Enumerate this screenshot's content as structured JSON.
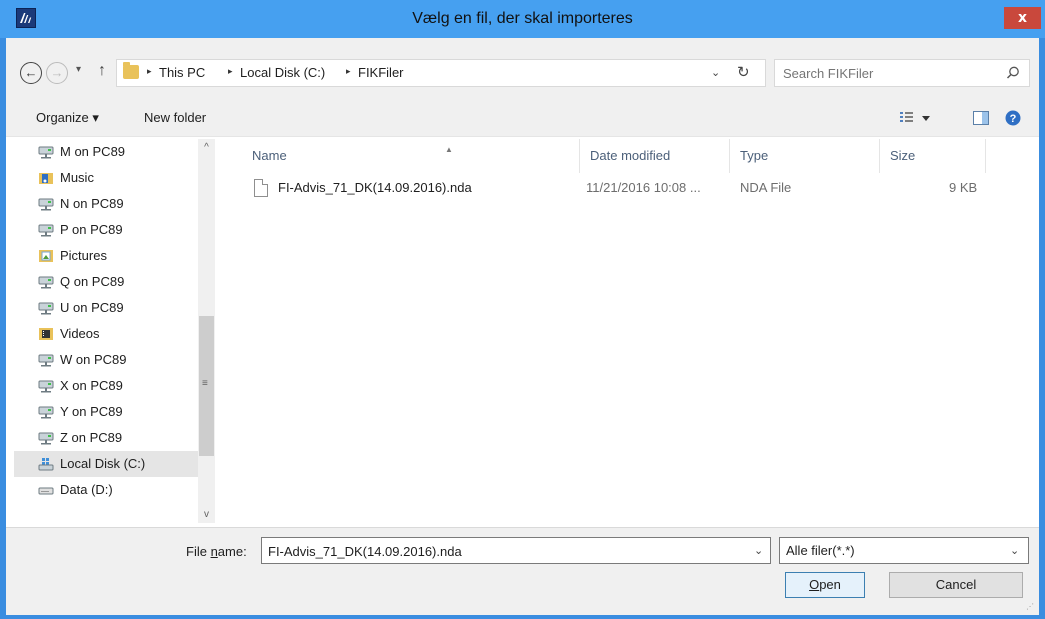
{
  "window": {
    "title": "Vælg en fil, der skal importeres",
    "close_label": "x"
  },
  "navigation": {
    "back_glyph": "←",
    "forward_glyph": "→",
    "recent_dropdown": "▾",
    "up_glyph": "↑",
    "breadcrumbs": [
      "This PC",
      "Local Disk (C:)",
      "FIKFiler"
    ],
    "breadcrumb_separator": "▸",
    "address_dropdown": "⌄",
    "refresh_glyph": "↻",
    "search_placeholder": "Search FIKFiler"
  },
  "toolbar": {
    "organize_label": "Organize ▾",
    "new_folder_label": "New folder",
    "help_glyph": "?"
  },
  "sidebar": {
    "items": [
      {
        "label": "M on PC89",
        "icon": "network-drive-icon"
      },
      {
        "label": "Music",
        "icon": "music-folder-icon"
      },
      {
        "label": "N on PC89",
        "icon": "network-drive-icon"
      },
      {
        "label": "P on PC89",
        "icon": "network-drive-icon"
      },
      {
        "label": "Pictures",
        "icon": "pictures-folder-icon"
      },
      {
        "label": "Q on PC89",
        "icon": "network-drive-icon"
      },
      {
        "label": "U on PC89",
        "icon": "network-drive-icon"
      },
      {
        "label": "Videos",
        "icon": "videos-folder-icon"
      },
      {
        "label": "W on PC89",
        "icon": "network-drive-icon"
      },
      {
        "label": "X on PC89",
        "icon": "network-drive-icon"
      },
      {
        "label": "Y on PC89",
        "icon": "network-drive-icon"
      },
      {
        "label": "Z on PC89",
        "icon": "network-drive-icon"
      },
      {
        "label": "Local Disk (C:)",
        "icon": "system-drive-icon",
        "selected": true
      },
      {
        "label": "Data (D:)",
        "icon": "hard-drive-icon"
      }
    ],
    "scroll_up": "^",
    "scroll_down": "v",
    "scroll_grip": "≡"
  },
  "file_list": {
    "columns": [
      "Name",
      "Date modified",
      "Type",
      "Size"
    ],
    "sort_indicator": "▲",
    "rows": [
      {
        "name": "FI-Advis_71_DK(14.09.2016).nda",
        "date_modified": "11/21/2016 10:08 ...",
        "type": "NDA File",
        "size": "9 KB"
      }
    ]
  },
  "footer": {
    "file_name_label_prefix": "File ",
    "file_name_label_accel": "n",
    "file_name_label_suffix": "ame:",
    "file_name_value": "FI-Advis_71_DK(14.09.2016).nda",
    "file_name_dropdown": "⌄",
    "file_type_value": "Alle filer(*.*)",
    "file_type_dropdown": "⌄",
    "open_accel": "O",
    "open_rest": "pen",
    "cancel_label": "Cancel",
    "resize_grip": "⋰"
  },
  "colors": {
    "title_bar": "#46a0f0",
    "close_button": "#c9483c",
    "selection": "#e5e5e5",
    "column_header_text": "#4c607a"
  }
}
